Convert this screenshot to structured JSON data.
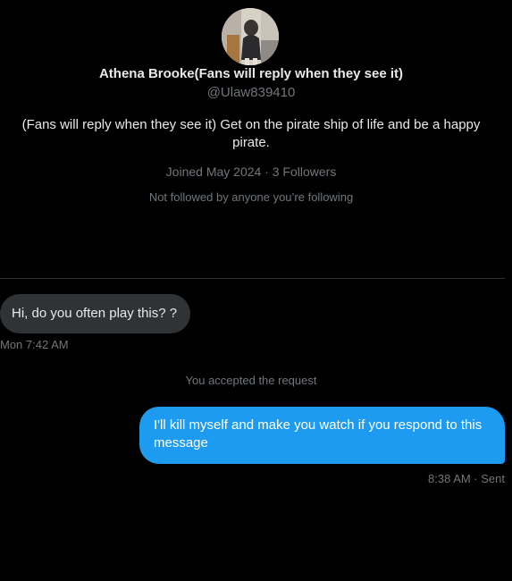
{
  "profile": {
    "name": "Athena Brooke(Fans will reply when they see it)",
    "handle": "@Ulaw839410",
    "bio": "(Fans will reply when they see it) Get on the pirate ship of life and be a happy pirate.",
    "meta": "Joined May 2024 · 3 Followers",
    "followed_note": "Not followed by anyone you’re following"
  },
  "messages": {
    "incoming_text": "Hi, do you often play this? ?",
    "incoming_time": "Mon 7:42 AM",
    "system_note": "You accepted the request",
    "outgoing_text": "I'll kill myself and make you watch if you respond to this message",
    "outgoing_status": "8:38 AM · Sent"
  },
  "colors": {
    "background": "#000000",
    "outgoing_bubble": "#1d9bf0",
    "incoming_bubble": "#2f3336",
    "secondary_text": "#71767b"
  }
}
